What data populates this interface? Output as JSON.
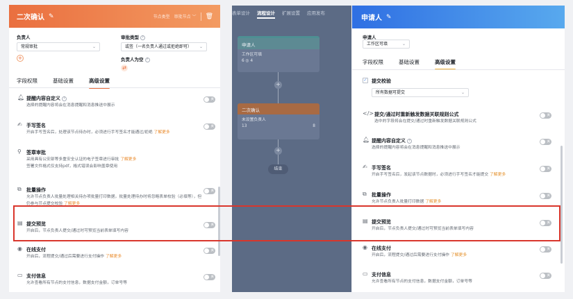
{
  "left": {
    "title": "二次确认",
    "node_type_label": "节点类型",
    "node_type_value": "审批节点",
    "assignee_label": "负责人",
    "assignee_select": "常规审批",
    "approval_type_label": "审批类型",
    "approval_type_select": "或签（一名负责人通过或拒绝即可）",
    "empty_assignee_label": "负责人为空",
    "tabs": [
      "字段权限",
      "基础设置",
      "高级设置"
    ],
    "settings": [
      {
        "title": "提醒内容自定义",
        "desc": "选择的提醒内容将会在消息提醒和消息推送中展示",
        "link": ""
      },
      {
        "title": "手写签名",
        "desc": "开启手写签名后，处理该节点待办时，必须进行手写签名才能通过/拒绝",
        "link": "了解更多"
      },
      {
        "title": "签章审批",
        "desc": "采用具有公安部等多重安全认证的电子签章进行审批",
        "link": "了解更多",
        "desc2": "签署文件格式仅支持pdf，格式错误会影响盖章使用"
      },
      {
        "title": "批量操作",
        "desc": "允许节点负责人批量处理相关待办项批量打印数据，批量处理待办时将忽略表单校验（必填等），但",
        "desc2": "仍参与节点提交校验",
        "link": "了解更多"
      },
      {
        "title": "提交预览",
        "desc": "开启后，节点负责人提交/通过时可预览当前表单填写内容",
        "link": ""
      },
      {
        "title": "在线支付",
        "desc": "开启后，流程提交/通过后需要进行支付操作",
        "link": "了解更多"
      },
      {
        "title": "支付信息",
        "desc": "允许查看所有节点的支付信息，数据支付金额，订单号等",
        "link": ""
      }
    ]
  },
  "middle": {
    "tabs": [
      "表单设计",
      "流程设计",
      "扩展设置",
      "应用发布"
    ],
    "node1": {
      "title": "申请人",
      "line1": "工作区可填",
      "meta": "6 ◎ 4"
    },
    "node2": {
      "title": "二次确认",
      "line1": "未设置负责人",
      "meta": "13",
      "meta2": "8"
    },
    "end_label": "结束"
  },
  "right": {
    "title": "申请人",
    "applicant_label": "申请人",
    "applicant_select": "工作区可填",
    "tabs": [
      "字段权限",
      "基础设置",
      "高级设置"
    ],
    "submit_check_label": "提交校验",
    "submit_check_select": "所有数据可提交",
    "settings": [
      {
        "title": "提交/通过时重新触发数据关联规则公式",
        "desc": "选中的字段将会在提交/通过时重新触发数据关联规则公式",
        "link": ""
      },
      {
        "title": "提醒内容自定义",
        "desc": "选择的提醒内容将会在消息提醒和消息推送中展示",
        "link": ""
      },
      {
        "title": "手写签名",
        "desc": "开启手写签名后，发起该节点数据时，必须进行手写签名才能提交",
        "link": "了解更多"
      },
      {
        "title": "批量操作",
        "desc": "允许节点负责人批量打印数据",
        "link": "了解更多"
      },
      {
        "title": "提交预览",
        "desc": "开启后，节点负责人提交/通过时可预览当前表单填写内容",
        "link": ""
      },
      {
        "title": "在线支付",
        "desc": "开启后，流程提交/通过后需要进行支付操作",
        "link": "了解更多"
      },
      {
        "title": "支付信息",
        "desc": "允许查看所有节点的支付信息，数据支付金额，订单号等",
        "link": ""
      }
    ]
  }
}
